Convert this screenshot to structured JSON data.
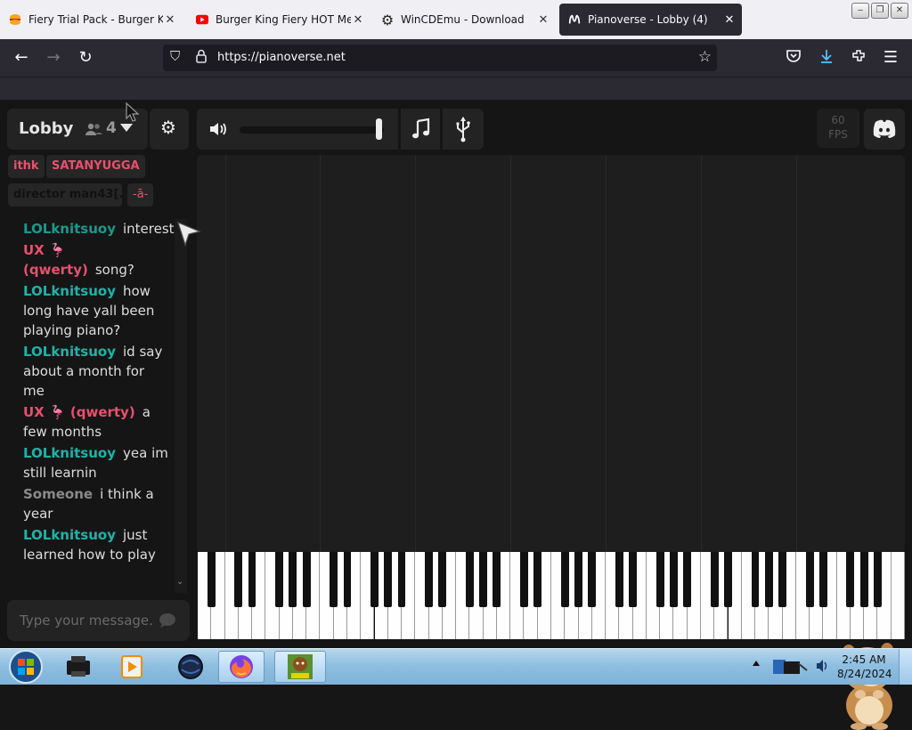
{
  "browser": {
    "tabs": [
      {
        "title": "Fiery Trial Pack - Burger King",
        "icon": "burger-king-icon"
      },
      {
        "title": "Burger King Fiery HOT Menu",
        "icon": "youtube-icon"
      },
      {
        "title": "WinCDEmu - Download",
        "icon": "gear-icon"
      },
      {
        "title": "Pianoverse - Lobby (4)",
        "icon": "pianoverse-icon",
        "active": true
      }
    ],
    "url": "https://pianoverse.net"
  },
  "room": {
    "name": "Lobby",
    "user_count": "4"
  },
  "users": [
    "ithk",
    "SATANYUGGA",
    "director man43[...",
    "-ā-"
  ],
  "chat": {
    "messages": [
      {
        "user": "LOLknitsuoy",
        "text": "interesting",
        "color": "#1a9a8c"
      },
      {
        "user": "UX 🦩 (qwerty)",
        "text": "song?",
        "color": "#e8506e"
      },
      {
        "user": "LOLknitsuoy",
        "text": "how long have yall been playing piano?",
        "color": "#20b2aa"
      },
      {
        "user": "LOLknitsuoy",
        "text": "id say about a month for me",
        "color": "#20b2aa"
      },
      {
        "user": "UX 🦩 (qwerty)",
        "text": "a few months",
        "color": "#e8506e"
      },
      {
        "user": "LOLknitsuoy",
        "text": "yea im still learnin",
        "color": "#20b2aa"
      },
      {
        "user": "Someone",
        "text": "i think a year",
        "color": "#8a8a8a"
      },
      {
        "user": "LOLknitsuoy",
        "text": "just learned how to play",
        "color": "#20b2aa"
      }
    ],
    "placeholder": "Type your message..."
  },
  "stats": {
    "fps_value": "60",
    "fps_label": "FPS"
  },
  "audio": {
    "volume_level": 0.97
  },
  "taskbar": {
    "time": "2:45 AM",
    "date": "8/24/2024"
  }
}
